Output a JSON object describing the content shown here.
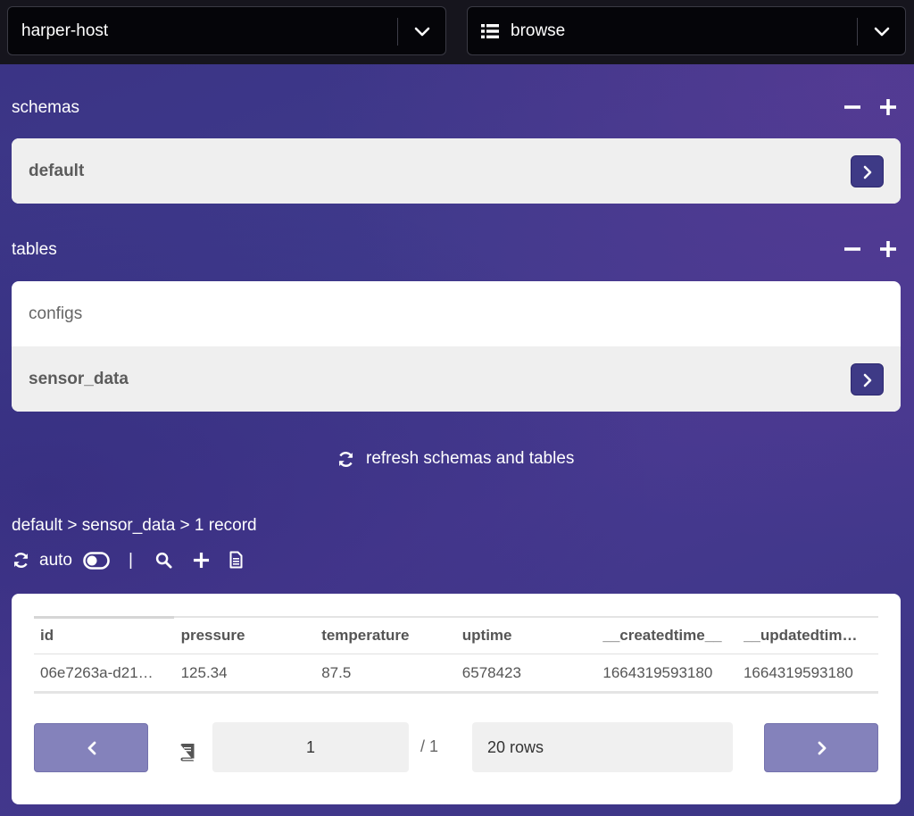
{
  "topbar": {
    "host_select": {
      "value": "harper-host"
    },
    "view_select": {
      "value": "browse"
    }
  },
  "schemas": {
    "label": "schemas",
    "items": [
      {
        "label": "default",
        "active": true
      }
    ]
  },
  "tables": {
    "label": "tables",
    "items": [
      {
        "label": "configs",
        "active": false
      },
      {
        "label": "sensor_data",
        "active": true
      }
    ]
  },
  "refresh_label": "refresh schemas and tables",
  "breadcrumb": "default > sensor_data > 1 record",
  "toolbar": {
    "auto_label": "auto",
    "divider": "|"
  },
  "table": {
    "columns": [
      "id",
      "pressure",
      "temperature",
      "uptime",
      "__createdtime__",
      "__updatedtim…"
    ],
    "rows": [
      [
        "06e7263a-d21…",
        "125.34",
        "87.5",
        "6578423",
        "1664319593180",
        "1664319593180"
      ]
    ]
  },
  "pagination": {
    "page": "1",
    "total": "/ 1",
    "rows_per_page": "20 rows"
  },
  "colors": {
    "accent": "#3e3a86",
    "pager_button": "#8482bb",
    "topbar": "#16151d"
  }
}
